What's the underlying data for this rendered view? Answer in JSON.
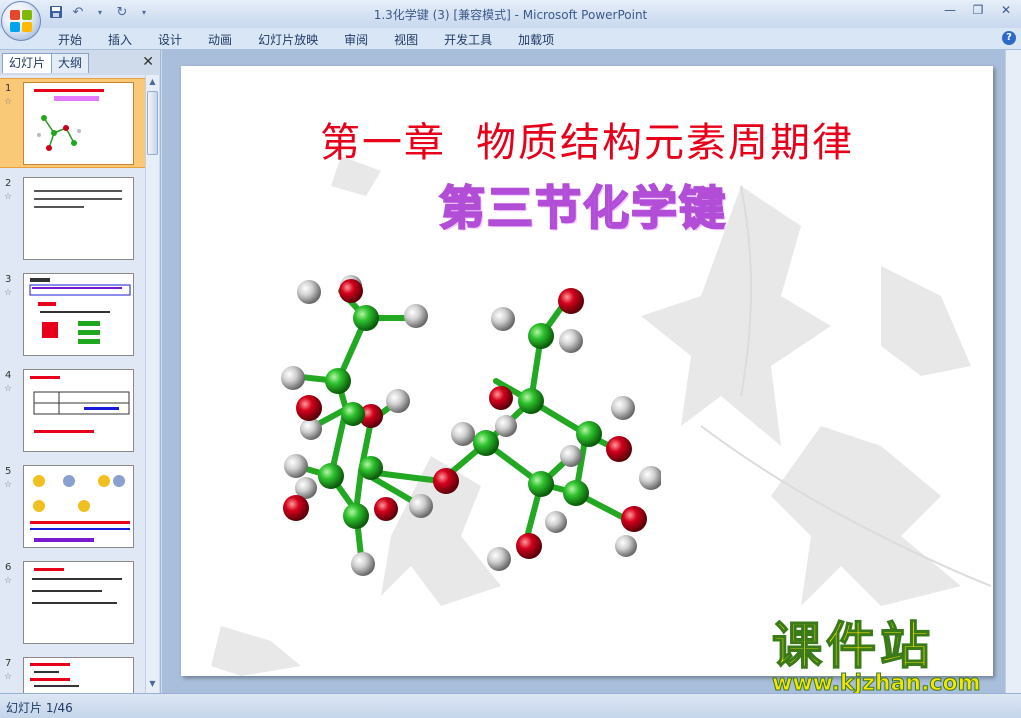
{
  "window": {
    "title": "1.3化学键 (3) [兼容模式] - Microsoft PowerPoint"
  },
  "qat": {
    "save_icon": "save-icon",
    "undo_icon": "undo-icon",
    "redo_icon": "redo-icon"
  },
  "ribbon": {
    "tabs": [
      "开始",
      "插入",
      "设计",
      "动画",
      "幻灯片放映",
      "审阅",
      "视图",
      "开发工具",
      "加载项"
    ]
  },
  "left_pane": {
    "tabs": [
      "幻灯片",
      "大纲"
    ],
    "slides": [
      {
        "num": "1"
      },
      {
        "num": "2"
      },
      {
        "num": "3"
      },
      {
        "num": "4"
      },
      {
        "num": "5"
      },
      {
        "num": "6"
      },
      {
        "num": "7"
      }
    ]
  },
  "slide": {
    "title": "第一章",
    "title2": "物质结构元素周期律",
    "subtitle": "第三节化学键"
  },
  "statusbar": {
    "text": "幻灯片 1/46"
  },
  "watermark": {
    "brand": "课件站",
    "url": "www.kjzhan.com"
  },
  "colors": {
    "title_red": "#e8001a",
    "subtitle_purple": "#e57cff",
    "selected_thumb": "#f9c978",
    "carbon": "#1fa81f",
    "oxygen": "#c8001a",
    "hydrogen": "#c8c8c8"
  }
}
